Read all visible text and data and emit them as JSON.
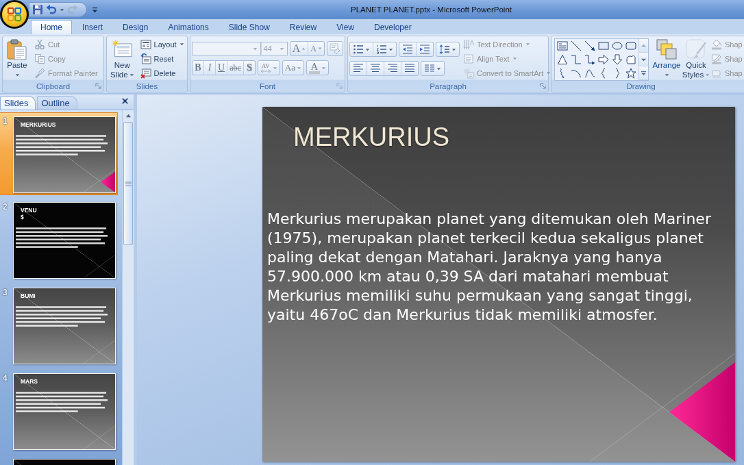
{
  "window": {
    "title": "PLANET PLANET.pptx - Microsoft PowerPoint"
  },
  "quick_access": [
    {
      "kind": "save",
      "disabled": false
    },
    {
      "kind": "undo",
      "disabled": false
    },
    {
      "kind": "undo_menu",
      "disabled": false
    },
    {
      "kind": "redo",
      "disabled": true
    },
    {
      "kind": "customize",
      "disabled": false
    }
  ],
  "tabs": [
    {
      "label": "Home",
      "selected": true
    },
    {
      "label": "Insert",
      "selected": false
    },
    {
      "label": "Design",
      "selected": false
    },
    {
      "label": "Animations",
      "selected": false
    },
    {
      "label": "Slide Show",
      "selected": false
    },
    {
      "label": "Review",
      "selected": false
    },
    {
      "label": "View",
      "selected": false
    },
    {
      "label": "Developer",
      "selected": false
    }
  ],
  "ribbon": {
    "clipboard": {
      "label": "Clipboard",
      "paste_label": "Paste",
      "items": [
        {
          "kind": "cut",
          "label": "Cut",
          "disabled": true
        },
        {
          "kind": "copy",
          "label": "Copy",
          "disabled": true
        },
        {
          "kind": "format_painter",
          "label": "Format Painter",
          "disabled": true
        }
      ]
    },
    "slides": {
      "label": "Slides",
      "new_slide_lines": [
        "New",
        "Slide"
      ],
      "items": [
        {
          "kind": "layout",
          "label": "Layout",
          "dropdown": true
        },
        {
          "kind": "reset",
          "label": "Reset",
          "dropdown": false
        },
        {
          "kind": "delete",
          "label": "Delete",
          "dropdown": false
        }
      ]
    },
    "font": {
      "label": "Font",
      "disabled": true,
      "size": "44",
      "row_1_groups": [
        [
          {
            "kind": "grow",
            "label": "A"
          },
          {
            "kind": "shrink",
            "label": "A"
          }
        ],
        [
          {
            "kind": "clear"
          }
        ]
      ],
      "row_2_groups": [
        [
          {
            "kind": "bold",
            "label": "B",
            "dropdown": false
          },
          {
            "kind": "italic",
            "label": "I",
            "dropdown": false
          },
          {
            "kind": "underline",
            "label": "U",
            "dropdown": false
          },
          {
            "kind": "strikethrough",
            "label": "abc",
            "dropdown": false
          },
          {
            "kind": "shadow",
            "label": "S",
            "dropdown": false
          }
        ],
        [
          {
            "kind": "spacing",
            "label": "AV",
            "dropdown": true
          }
        ],
        [
          {
            "kind": "case",
            "label": "Aa",
            "dropdown": true
          }
        ],
        [
          {
            "kind": "color",
            "label": "A",
            "dropdown": true
          }
        ]
      ]
    },
    "paragraph": {
      "label": "Paragraph",
      "row_1_groups": [
        [
          {
            "kind": "bullets",
            "dropdown": true
          },
          {
            "kind": "numbering",
            "dropdown": true
          }
        ],
        [
          {
            "kind": "decrease_indent",
            "dropdown": false
          },
          {
            "kind": "increase_indent",
            "dropdown": false
          }
        ],
        [
          {
            "kind": "line_spacing",
            "dropdown": true
          }
        ]
      ],
      "commands": [
        {
          "kind": "text_direction",
          "label": "Text Direction",
          "disabled": true,
          "dropdown": true
        },
        {
          "kind": "align_text",
          "label": "Align Text",
          "disabled": true,
          "dropdown": true
        },
        {
          "kind": "smartart",
          "label": "Convert to SmartArt",
          "disabled": true,
          "dropdown": true
        }
      ],
      "row_2_groups": [
        [
          {
            "kind": "align_left",
            "dropdown": false
          },
          {
            "kind": "center",
            "dropdown": false
          },
          {
            "kind": "align_right",
            "dropdown": false
          },
          {
            "kind": "justify",
            "dropdown": false
          }
        ],
        [
          {
            "kind": "columns",
            "dropdown": true
          }
        ]
      ]
    },
    "drawing": {
      "label": "Drawing",
      "shapes": [
        {
          "kind": "text_box"
        },
        {
          "kind": "line"
        },
        {
          "kind": "arrow"
        },
        {
          "kind": "rectangle"
        },
        {
          "kind": "oval"
        },
        {
          "kind": "rounded_rectangle"
        },
        {
          "kind": "triangle"
        },
        {
          "kind": "elbow_connector"
        },
        {
          "kind": "elbow_arrow"
        },
        {
          "kind": "right_arrow"
        },
        {
          "kind": "down_arrow"
        },
        {
          "kind": "flowchart"
        },
        {
          "kind": "freeform"
        },
        {
          "kind": "arc"
        },
        {
          "kind": "curve"
        },
        {
          "kind": "left_brace"
        },
        {
          "kind": "right_brace"
        },
        {
          "kind": "star"
        }
      ],
      "arrange_label": "Arrange",
      "quick_styles": {
        "lines": [
          "Quick",
          "Styles"
        ],
        "disabled": true
      },
      "shape_commands": [
        {
          "kind": "fill",
          "label": "Shap",
          "disabled": true
        },
        {
          "kind": "outline",
          "label": "Shap",
          "disabled": true
        },
        {
          "kind": "effects",
          "label": "Shap",
          "disabled": true
        }
      ]
    }
  },
  "slides_panel": {
    "tabs": [
      {
        "label": "Slides",
        "selected": true
      },
      {
        "label": "Outline",
        "selected": false
      }
    ],
    "thumbnails": [
      {
        "number": "1",
        "title_lines": [
          "MERKURIUS"
        ],
        "kind": "gray",
        "triangle": true,
        "selected": true
      },
      {
        "number": "2",
        "title_lines": [
          "VENU",
          "$"
        ],
        "kind": "black",
        "triangle": false,
        "selected": false
      },
      {
        "number": "3",
        "title_lines": [
          "BUMI"
        ],
        "kind": "gray",
        "triangle": false,
        "selected": false
      },
      {
        "number": "4",
        "title_lines": [
          "MARS"
        ],
        "kind": "gray",
        "triangle": false,
        "selected": false
      },
      {
        "kind": "black",
        "selected": false
      }
    ]
  },
  "slide": {
    "title": "MERKURIUS",
    "body": "Merkurius merupakan planet yang ditemukan oleh Mariner (1975), merupakan planet terkecil kedua sekaligus planet paling dekat dengan Matahari. Jaraknya yang hanya 57.900.000 km atau 0,39 SA dari matahari membuat Merkurius memiliki suhu permukaan yang sangat tinggi, yaitu 467oC dan Merkurius tidak memiliki atmosfer."
  }
}
